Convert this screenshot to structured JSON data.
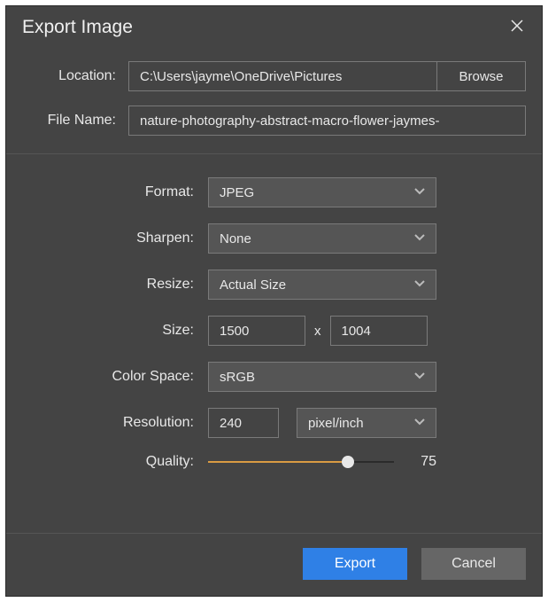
{
  "dialog": {
    "title": "Export Image"
  },
  "location": {
    "label": "Location:",
    "path": "C:\\Users\\jayme\\OneDrive\\Pictures",
    "browse": "Browse"
  },
  "filename": {
    "label": "File Name:",
    "value": "nature-photography-abstract-macro-flower-jaymes-"
  },
  "format": {
    "label": "Format:",
    "value": "JPEG"
  },
  "sharpen": {
    "label": "Sharpen:",
    "value": "None"
  },
  "resize": {
    "label": "Resize:",
    "value": "Actual Size"
  },
  "size": {
    "label": "Size:",
    "width": "1500",
    "separator": "x",
    "height": "1004"
  },
  "colorspace": {
    "label": "Color Space:",
    "value": "sRGB"
  },
  "resolution": {
    "label": "Resolution:",
    "value": "240",
    "unit": "pixel/inch"
  },
  "quality": {
    "label": "Quality:",
    "value": "75",
    "percent": 75
  },
  "footer": {
    "export": "Export",
    "cancel": "Cancel"
  }
}
